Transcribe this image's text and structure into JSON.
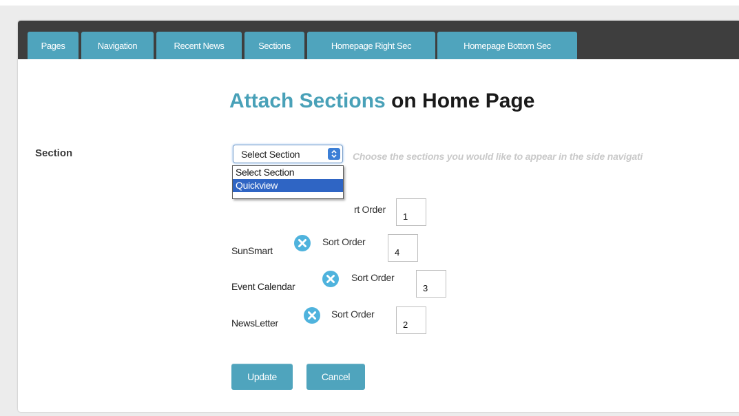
{
  "tabs": [
    {
      "label": "Pages"
    },
    {
      "label": "Navigation"
    },
    {
      "label": "Recent News"
    },
    {
      "label": "Sections"
    },
    {
      "label": "Homepage Right Sec"
    },
    {
      "label": "Homepage Bottom Sec"
    }
  ],
  "heading": {
    "accent": "Attach Sections",
    "rest": "on Home Page"
  },
  "form": {
    "section_label": "Section",
    "select": {
      "value": "Select Section",
      "options": [
        "Select Section",
        "Quickview"
      ],
      "highlighted": "Quickview"
    },
    "hint": "Choose the sections you would like to appear in the side navigati"
  },
  "sections": [
    {
      "name": "",
      "sort_label": "rt Order",
      "sort_value": "1"
    },
    {
      "name": "SunSmart",
      "sort_label": "Sort Order",
      "sort_value": "4"
    },
    {
      "name": "Event Calendar",
      "sort_label": "Sort Order",
      "sort_value": "3"
    },
    {
      "name": "NewsLetter",
      "sort_label": "Sort Order",
      "sort_value": "2"
    }
  ],
  "buttons": {
    "update": "Update",
    "cancel": "Cancel"
  },
  "colors": {
    "accent": "#49a1b8",
    "tab": "#4fa4bd",
    "tabbar": "#3e3e3e",
    "remove_icon": "#4fb3dd",
    "select_highlight": "#2f65c4"
  },
  "icons": {
    "remove": "circle-x-icon",
    "select_arrow": "updown-chevron-icon"
  }
}
